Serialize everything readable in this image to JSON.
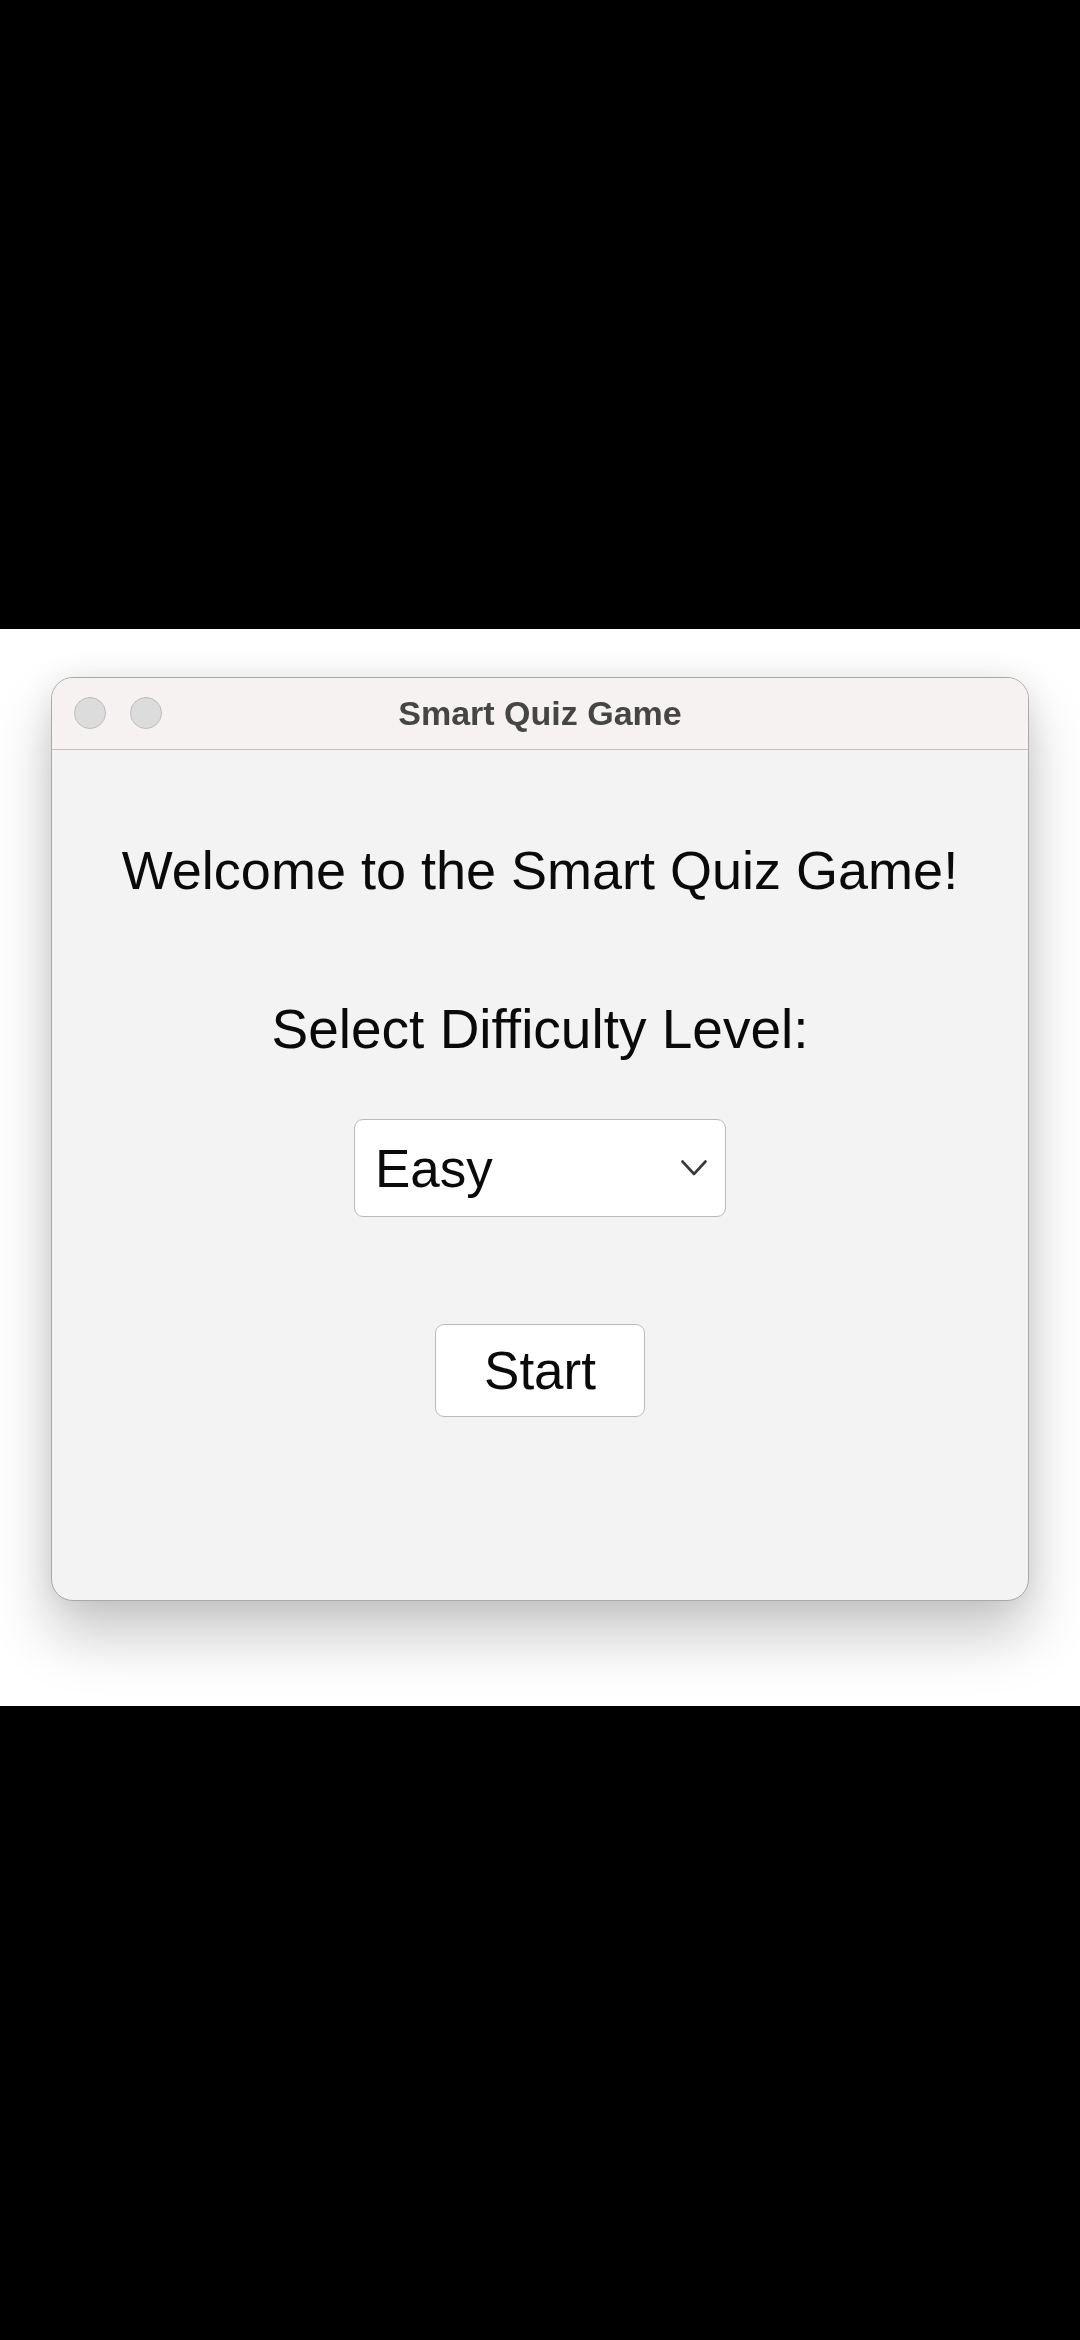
{
  "window": {
    "title": "Smart Quiz Game"
  },
  "heading": "Welcome to the Smart Quiz Game!",
  "difficulty": {
    "label": "Select Difficulty Level:",
    "value": "Easy"
  },
  "buttons": [
    "Start"
  ]
}
